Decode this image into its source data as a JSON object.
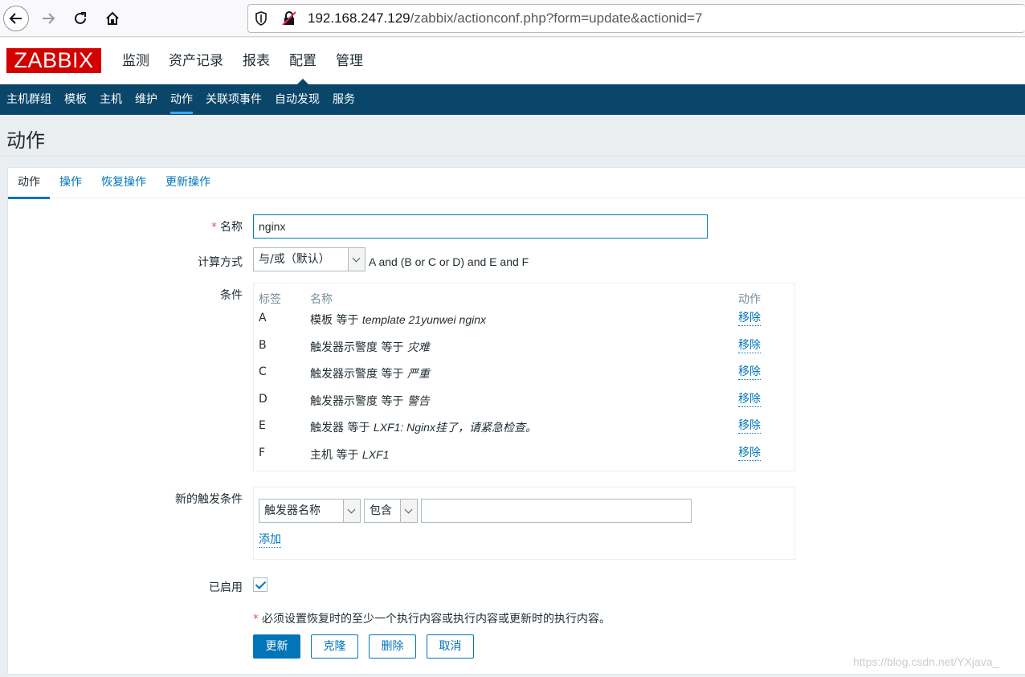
{
  "browser": {
    "url_host": "192.168.247.129",
    "url_path": "/zabbix/actionconf.php?form=update&actionid=7"
  },
  "header": {
    "logo": "ZABBIX",
    "menu": [
      "监测",
      "资产记录",
      "报表",
      "配置",
      "管理"
    ],
    "active_menu": "配置"
  },
  "subnav": {
    "items": [
      "主机群组",
      "模板",
      "主机",
      "维护",
      "动作",
      "关联项事件",
      "自动发现",
      "服务"
    ],
    "active": "动作"
  },
  "page": {
    "title": "动作"
  },
  "tabs": [
    "动作",
    "操作",
    "恢复操作",
    "更新操作"
  ],
  "form": {
    "name_label": "名称",
    "name_value": "nginx",
    "calc_label": "计算方式",
    "calc_value": "与/或（默认）",
    "calc_expression": "A and (B or C or D) and E and F",
    "conditions_label": "条件",
    "cond_headers": {
      "label": "标签",
      "name": "名称",
      "action": "动作"
    },
    "conditions": [
      {
        "label": "A",
        "text": "模板 等于 ",
        "value": "template 21yunwei nginx",
        "action": "移除"
      },
      {
        "label": "B",
        "text": "触发器示警度 等于 ",
        "value": "灾难",
        "action": "移除"
      },
      {
        "label": "C",
        "text": "触发器示警度 等于 ",
        "value": "严重",
        "action": "移除"
      },
      {
        "label": "D",
        "text": "触发器示警度 等于 ",
        "value": "警告",
        "action": "移除"
      },
      {
        "label": "E",
        "text": "触发器 等于 ",
        "value": "LXF1: Nginx挂了，请紧急检查。",
        "action": "移除"
      },
      {
        "label": "F",
        "text": "主机 等于 ",
        "value": "LXF1",
        "action": "移除"
      }
    ],
    "new_condition_label": "新的触发条件",
    "new_condition_type": "触发器名称",
    "new_condition_operator": "包含",
    "new_condition_value": "",
    "add_link": "添加",
    "enabled_label": "已启用",
    "enabled": true,
    "note": "必须设置恢复时的至少一个执行内容或执行内容或更新时的执行内容。",
    "buttons": {
      "update": "更新",
      "clone": "克隆",
      "delete": "删除",
      "cancel": "取消"
    }
  },
  "watermark": "https://blog.csdn.net/YXjava_",
  "colors": {
    "brand": "#d40000",
    "nav": "#0a466a",
    "link": "#0275b8",
    "required": "#e45959"
  }
}
